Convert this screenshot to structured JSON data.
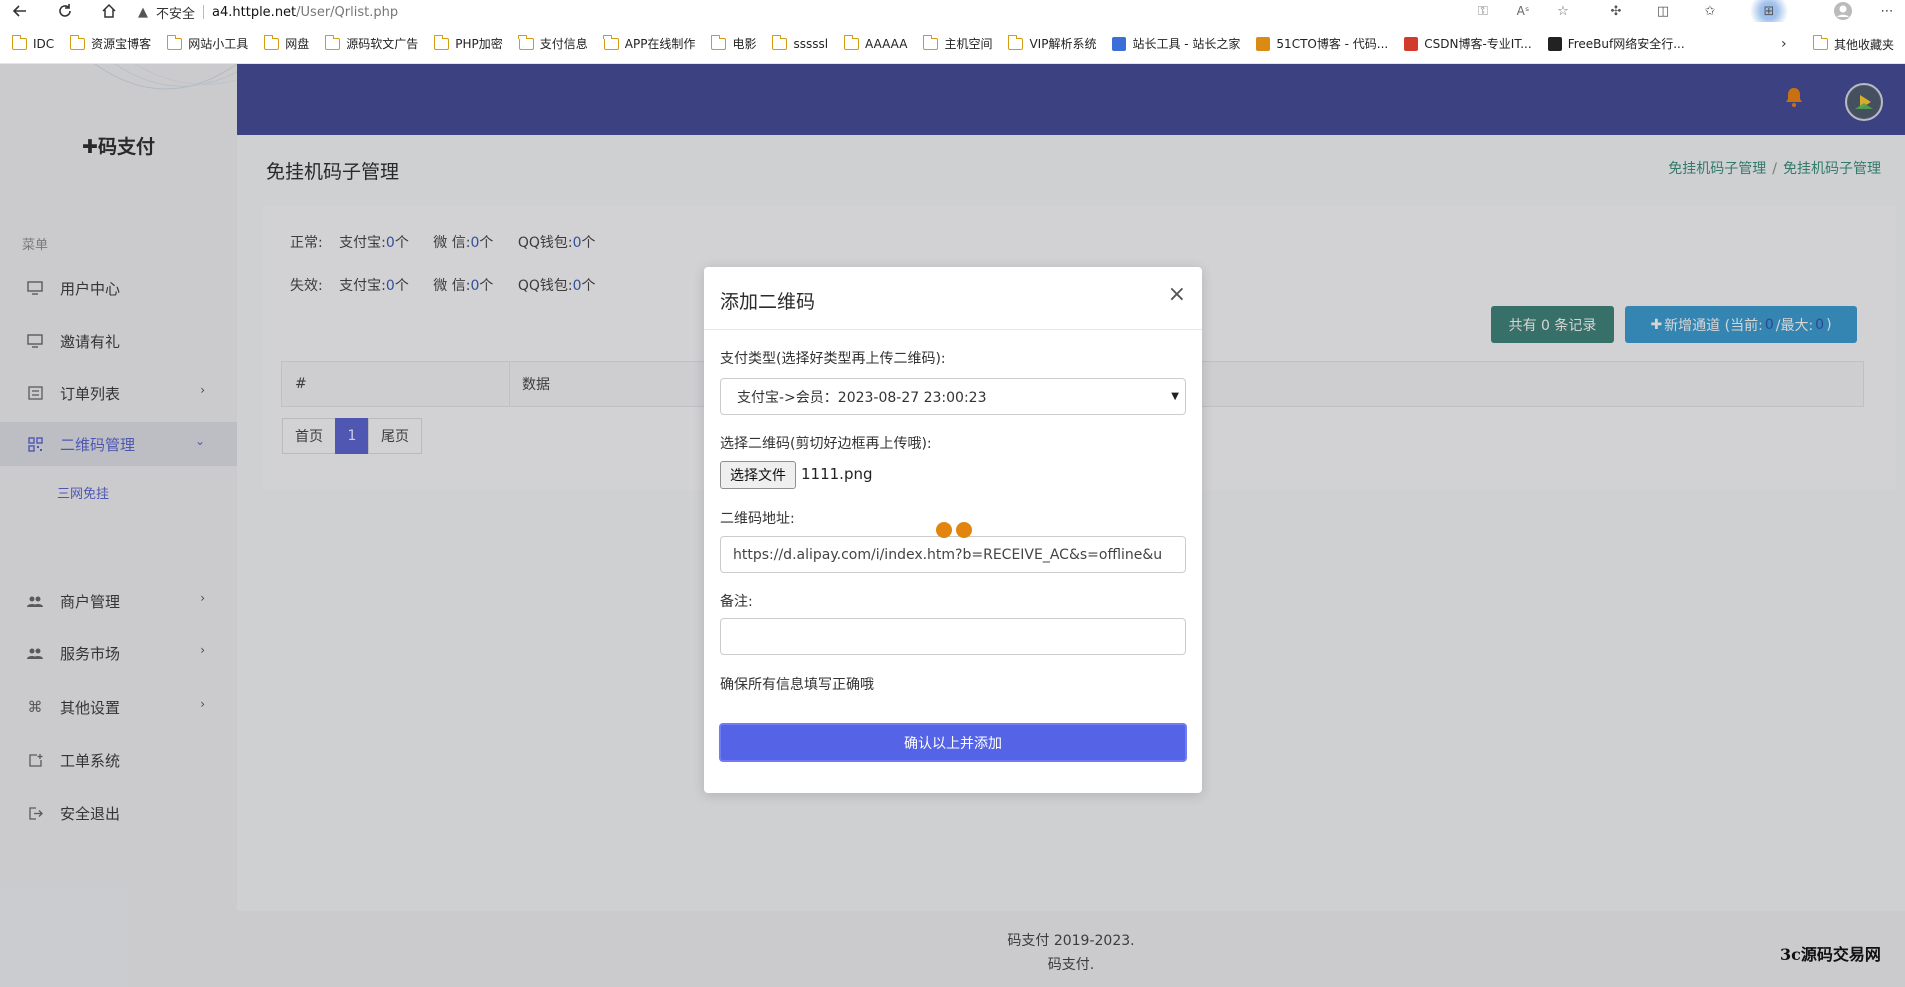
{
  "browser": {
    "security_label": "不安全",
    "url_host": "a4.httple.net",
    "url_path": "/User/Qrlist.php",
    "bookmarks": [
      {
        "label": "IDC",
        "kind": "folder"
      },
      {
        "label": "资源宝博客",
        "kind": "folder"
      },
      {
        "label": "网站小工具",
        "kind": "folder"
      },
      {
        "label": "网盘",
        "kind": "folder"
      },
      {
        "label": "源码软文广告",
        "kind": "folder"
      },
      {
        "label": "PHP加密",
        "kind": "folder"
      },
      {
        "label": "支付信息",
        "kind": "folder"
      },
      {
        "label": "APP在线制作",
        "kind": "folder"
      },
      {
        "label": "电影",
        "kind": "folder"
      },
      {
        "label": "sssssl",
        "kind": "folder"
      },
      {
        "label": "AAAAA",
        "kind": "folder"
      },
      {
        "label": "主机空间",
        "kind": "folder"
      },
      {
        "label": "VIP解析系统",
        "kind": "folder"
      },
      {
        "label": "站长工具 - 站长之家",
        "kind": "site"
      },
      {
        "label": "51CTO博客 - 代码...",
        "kind": "site"
      },
      {
        "label": "CSDN博客-专业IT...",
        "kind": "site"
      },
      {
        "label": "FreeBuf网络安全行...",
        "kind": "site"
      }
    ],
    "other_bookmarks": "其他收藏夹"
  },
  "sidebar": {
    "brand": "码支付",
    "menu_header": "菜单",
    "items": [
      {
        "label": "用户中心"
      },
      {
        "label": "邀请有礼"
      },
      {
        "label": "订单列表"
      },
      {
        "label": "二维码管理"
      },
      {
        "label": "商户管理"
      },
      {
        "label": "服务市场"
      },
      {
        "label": "其他设置"
      },
      {
        "label": "工单系统"
      },
      {
        "label": "安全退出"
      }
    ],
    "sub_item": "三网免挂"
  },
  "page": {
    "title": "免挂机码子管理",
    "breadcrumb": [
      "免挂机码子管理",
      "免挂机码子管理"
    ],
    "normal_label": "正常:",
    "invalid_label": "失效:",
    "alipay_label": "支付宝:",
    "wechat_label": "微 信:",
    "qq_label": "QQ钱包:",
    "counts": {
      "alipay_ok": "0",
      "wechat_ok": "0",
      "qq_ok": "0",
      "alipay_bad": "0",
      "wechat_bad": "0",
      "qq_bad": "0"
    },
    "unit": "个",
    "total_btn": "共有 0 条记录",
    "new_channel_prefix": "新增通道 (当前:",
    "new_channel_current": "0",
    "new_channel_mid": "/最大:",
    "new_channel_max": "0",
    "new_channel_suffix": ")",
    "table_cols": [
      "#",
      "数据"
    ],
    "pager": [
      "首页",
      "1",
      "尾页"
    ]
  },
  "footer": {
    "line1": "码支付 2019-2023.",
    "line2": "码支付.",
    "watermark": "3c源码交易网"
  },
  "modal": {
    "title": "添加二维码",
    "close": "×",
    "pay_type_label": "支付类型(选择好类型再上传二维码):",
    "pay_type_value": "支付宝->会员：2023-08-27 23:00:23",
    "choose_qr_label": "选择二维码(剪切好边框再上传哦):",
    "file_btn": "选择文件",
    "file_name": "1111.png",
    "qr_url_label": "二维码地址:",
    "qr_url_value": "https://d.alipay.com/i/index.htm?b=RECEIVE_AC&s=offline&u",
    "remark_label": "备注:",
    "remark_value": "",
    "hint": "确保所有信息填写正确哦",
    "confirm_btn": "确认以上并添加"
  },
  "colors": {
    "header_bg": "#434a91",
    "accent": "#5a62c8",
    "confirm_btn": "#5563e6",
    "loader": "#e3840f"
  }
}
